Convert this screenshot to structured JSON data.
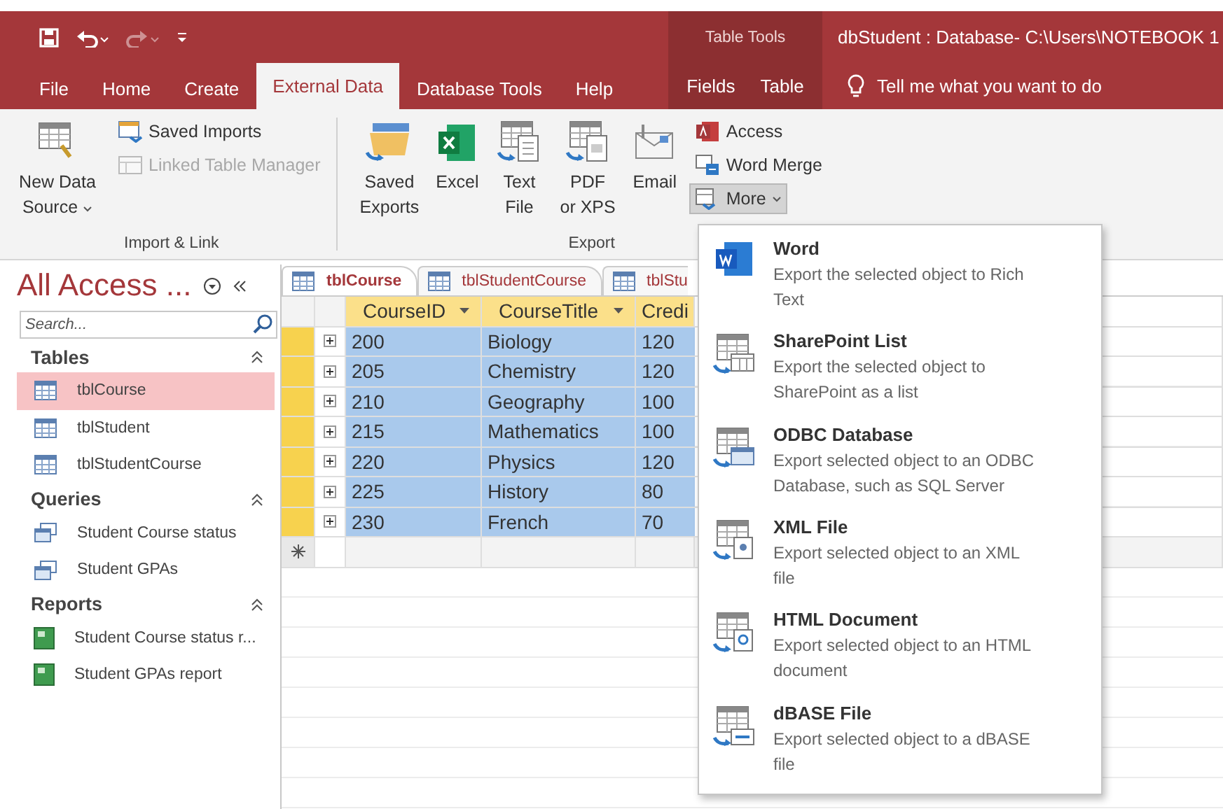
{
  "window": {
    "title": "dbStudent : Database- C:\\Users\\NOTEBOOK 1",
    "contextual_group": "Table Tools"
  },
  "ribbon_tabs": [
    {
      "label": "File",
      "selected": false,
      "kind": "normal"
    },
    {
      "label": "Home",
      "selected": false,
      "kind": "normal"
    },
    {
      "label": "Create",
      "selected": false,
      "kind": "normal"
    },
    {
      "label": "External Data",
      "selected": true,
      "kind": "normal"
    },
    {
      "label": "Database Tools",
      "selected": false,
      "kind": "normal"
    },
    {
      "label": "Help",
      "selected": false,
      "kind": "normal"
    },
    {
      "label": "Fields",
      "selected": false,
      "kind": "contextual"
    },
    {
      "label": "Table",
      "selected": false,
      "kind": "contextual"
    }
  ],
  "tell_me": "Tell me what you want to do",
  "ribbon_groups": [
    {
      "label": "Import & Link",
      "commands": [
        {
          "label": "New Data\nSource",
          "kind": "large",
          "dropdown": true,
          "disabled": false,
          "selected": false
        },
        {
          "label": "Saved Imports",
          "kind": "small",
          "dropdown": false,
          "disabled": false,
          "selected": false
        },
        {
          "label": "Linked Table Manager",
          "kind": "small",
          "dropdown": false,
          "disabled": true,
          "selected": false
        }
      ]
    },
    {
      "label": "Export",
      "commands": [
        {
          "label": "Saved\nExports",
          "kind": "large",
          "dropdown": false,
          "disabled": false,
          "selected": false
        },
        {
          "label": "Excel",
          "kind": "large",
          "dropdown": false,
          "disabled": false,
          "selected": false
        },
        {
          "label": "Text\nFile",
          "kind": "large",
          "dropdown": false,
          "disabled": false,
          "selected": false
        },
        {
          "label": "PDF\nor XPS",
          "kind": "large",
          "dropdown": false,
          "disabled": false,
          "selected": false
        },
        {
          "label": "Email",
          "kind": "large",
          "dropdown": false,
          "disabled": false,
          "selected": false
        },
        {
          "label": "Access",
          "kind": "small",
          "dropdown": false,
          "disabled": false,
          "selected": false
        },
        {
          "label": "Word Merge",
          "kind": "small",
          "dropdown": false,
          "disabled": false,
          "selected": false
        },
        {
          "label": "More",
          "kind": "small",
          "dropdown": true,
          "disabled": false,
          "selected": true
        }
      ]
    }
  ],
  "nav_pane": {
    "title": "All Access ...",
    "search": {
      "placeholder": "Search..."
    },
    "groups": [
      {
        "label": "Tables",
        "kind": "table",
        "expanded": true,
        "items": [
          {
            "label": "tblCourse",
            "selected": true
          },
          {
            "label": "tblStudent",
            "selected": false
          },
          {
            "label": "tblStudentCourse",
            "selected": false
          }
        ]
      },
      {
        "label": "Queries",
        "kind": "query",
        "expanded": true,
        "items": [
          {
            "label": "Student Course status",
            "selected": false
          },
          {
            "label": "Student GPAs",
            "selected": false
          }
        ]
      },
      {
        "label": "Reports",
        "kind": "report",
        "expanded": true,
        "items": [
          {
            "label": "Student Course status r...",
            "selected": false
          },
          {
            "label": "Student GPAs report",
            "selected": false
          }
        ]
      }
    ]
  },
  "doc_tabs": [
    {
      "label": "tblCourse",
      "selected": true
    },
    {
      "label": "tblStudentCourse",
      "selected": false
    },
    {
      "label": "tblStu",
      "selected": false
    }
  ],
  "datasheet": {
    "columns": [
      {
        "label": "CourseID",
        "filter_arrow": true
      },
      {
        "label": "CourseTitle",
        "filter_arrow": true
      },
      {
        "label": "Credi",
        "filter_arrow": false
      }
    ],
    "rows": [
      {
        "cells": [
          "200",
          "Biology",
          "120"
        ],
        "selected": true
      },
      {
        "cells": [
          "205",
          "Chemistry",
          "120"
        ],
        "selected": true
      },
      {
        "cells": [
          "210",
          "Geography",
          "100"
        ],
        "selected": true
      },
      {
        "cells": [
          "215",
          "Mathematics",
          "100"
        ],
        "selected": true
      },
      {
        "cells": [
          "220",
          "Physics",
          "120"
        ],
        "selected": true
      },
      {
        "cells": [
          "225",
          "History",
          "80"
        ],
        "selected": true
      },
      {
        "cells": [
          "230",
          "French",
          "70"
        ],
        "selected": true
      }
    ],
    "new_record_row": true
  },
  "more_menu": {
    "items": [
      {
        "title": "Word",
        "description": "Export the selected object to Rich Text"
      },
      {
        "title": "SharePoint List",
        "description": "Export the selected object to SharePoint as a list"
      },
      {
        "title": "ODBC Database",
        "description": "Export selected object to an ODBC Database, such as SQL Server"
      },
      {
        "title": "XML File",
        "description": "Export selected object to an XML file"
      },
      {
        "title": "HTML Document",
        "description": "Export selected object to an HTML document"
      },
      {
        "title": "dBASE File",
        "description": "Export selected object to a dBASE file"
      }
    ]
  }
}
